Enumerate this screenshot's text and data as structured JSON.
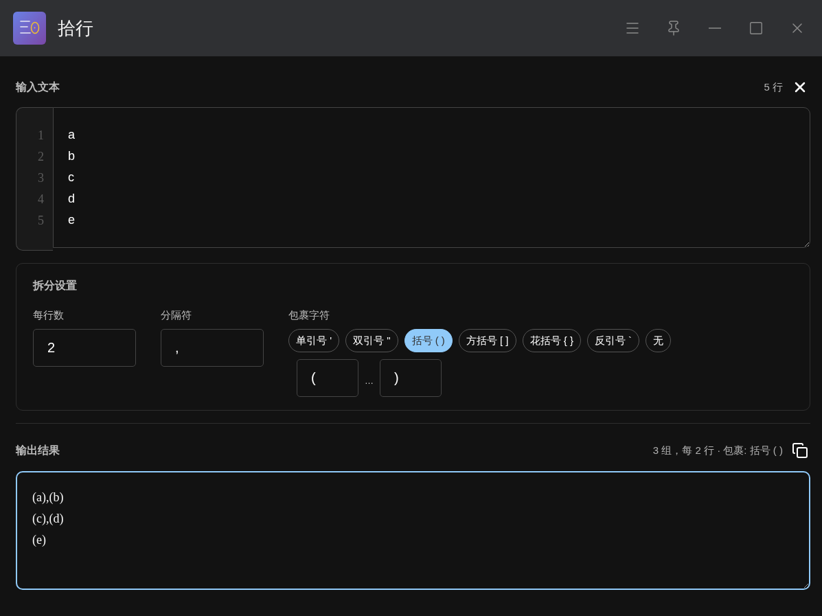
{
  "window": {
    "title": "拾行"
  },
  "input": {
    "title": "输入文本",
    "count": "5 行",
    "line_numbers": [
      "1",
      "2",
      "3",
      "4",
      "5"
    ],
    "lines": [
      "a",
      "b",
      "c",
      "d",
      "e"
    ]
  },
  "settings": {
    "title": "拆分设置",
    "per_line": {
      "label": "每行数",
      "value": "2"
    },
    "separator": {
      "label": "分隔符",
      "value": ","
    },
    "wrap": {
      "label": "包裹字符",
      "options": [
        {
          "label": "单引号 '",
          "selected": false
        },
        {
          "label": "双引号 \"",
          "selected": false
        },
        {
          "label": "括号 ( )",
          "selected": true
        },
        {
          "label": "方括号 [ ]",
          "selected": false
        },
        {
          "label": "花括号 { }",
          "selected": false
        },
        {
          "label": "反引号 `",
          "selected": false
        },
        {
          "label": "无",
          "selected": false
        }
      ],
      "open": "(",
      "ellipsis": "…",
      "close": ")"
    }
  },
  "output": {
    "title": "输出结果",
    "summary": "3 组，每 2 行 · 包裹: 括号 ( )",
    "lines": [
      "(a),(b)",
      "(c),(d)",
      "(e)"
    ],
    "focused": true
  }
}
